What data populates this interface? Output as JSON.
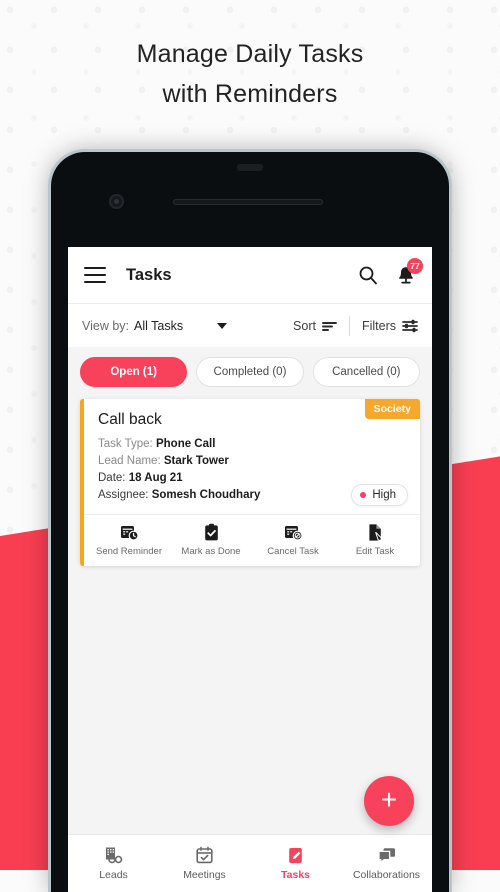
{
  "headline": {
    "line1": "Manage Daily Tasks",
    "line2": "with Reminders"
  },
  "colors": {
    "accent": "#f8415a",
    "tag_orange": "#f7a82a",
    "card_border": "#f5a623",
    "teal": "#3fd0ab",
    "background": "#fbfbfb"
  },
  "app_bar": {
    "menu_icon": "hamburger-icon",
    "title": "Tasks",
    "search_icon": "search-icon",
    "notification_icon": "bell-icon",
    "notification_count": "77"
  },
  "view_bar": {
    "label": "View by:",
    "value": "All Tasks",
    "caret_icon": "chevron-down-icon",
    "sort_label": "Sort",
    "sort_icon": "sort-lines-icon",
    "filters_label": "Filters",
    "filters_icon": "sliders-icon"
  },
  "tabs": [
    {
      "label": "Open (1)",
      "active": true
    },
    {
      "label": "Completed (0)",
      "active": false
    },
    {
      "label": "Cancelled (0)",
      "active": false
    }
  ],
  "task_card": {
    "tag": "Society",
    "title": "Call back",
    "fields": [
      {
        "key": "Task Type:",
        "value": "Phone Call"
      },
      {
        "key": "Lead Name:",
        "value": "Stark Tower"
      },
      {
        "key": "Date:",
        "value": "18 Aug 21"
      },
      {
        "key": "Assignee:",
        "value": "Somesh Choudhary"
      }
    ],
    "priority": "High",
    "actions": [
      {
        "label": "Send Reminder",
        "icon": "calendar-clock-icon"
      },
      {
        "label": "Mark as Done",
        "icon": "clipboard-check-icon"
      },
      {
        "label": "Cancel Task",
        "icon": "calendar-cancel-icon"
      },
      {
        "label": "Edit Task",
        "icon": "document-edit-icon"
      }
    ]
  },
  "fab": {
    "icon": "plus-icon",
    "label": "+"
  },
  "bottom_nav": [
    {
      "label": "Leads",
      "icon": "building-icon",
      "active": false
    },
    {
      "label": "Meetings",
      "icon": "calendar-check-icon",
      "active": false
    },
    {
      "label": "Tasks",
      "icon": "clipboard-pen-icon",
      "active": true
    },
    {
      "label": "Collaborations",
      "icon": "chat-bubbles-icon",
      "active": false
    }
  ]
}
